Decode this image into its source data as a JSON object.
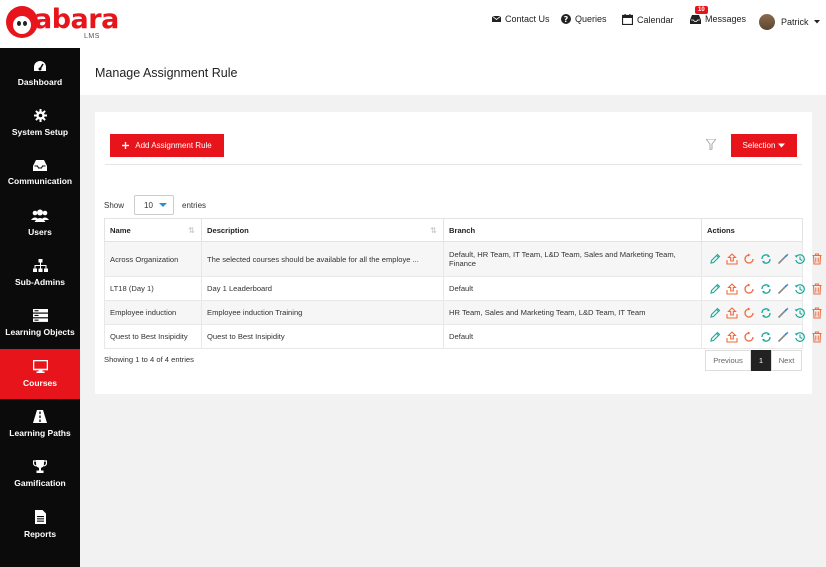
{
  "brand": {
    "logo_text": "abara",
    "logo_sub": "LMS"
  },
  "header": {
    "contact": "Contact Us",
    "queries": "Queries",
    "calendar": "Calendar",
    "messages": "Messages",
    "messages_badge": "10",
    "user": "Patrick"
  },
  "sidebar": {
    "items": [
      {
        "label": "Dashboard",
        "icon": "dashboard-icon"
      },
      {
        "label": "System Setup",
        "icon": "gear-icon"
      },
      {
        "label": "Communication",
        "icon": "inbox-icon"
      },
      {
        "label": "Users",
        "icon": "users-icon"
      },
      {
        "label": "Sub-Admins",
        "icon": "sitemap-icon"
      },
      {
        "label": "Learning Objects",
        "icon": "stack-icon"
      },
      {
        "label": "Courses",
        "icon": "monitor-icon"
      },
      {
        "label": "Learning Paths",
        "icon": "road-icon"
      },
      {
        "label": "Gamification",
        "icon": "trophy-icon"
      },
      {
        "label": "Reports",
        "icon": "document-icon"
      }
    ],
    "active": "Courses"
  },
  "page": {
    "title": "Manage Assignment Rule"
  },
  "toolbar": {
    "add_label": "Add Assignment Rule",
    "selection_label": "Selection"
  },
  "length": {
    "show": "Show",
    "value": "10",
    "entries": "entries"
  },
  "table": {
    "headers": {
      "name": "Name",
      "description": "Description",
      "branch": "Branch",
      "actions": "Actions"
    },
    "rows": [
      {
        "name": "Across Organization",
        "description": "The selected courses should be available for all the employe ...",
        "branch": "Default, HR Team, IT Team, L&D Team, Sales and Marketing Team, Finance"
      },
      {
        "name": "LT18 (Day 1)",
        "description": "Day 1 Leaderboard",
        "branch": "Default"
      },
      {
        "name": "Employee induction",
        "description": "Employee induction Training",
        "branch": "HR Team, Sales and Marketing Team, L&D Team, IT Team"
      },
      {
        "name": "Quest to Best Insipidity",
        "description": "Quest to Best Insipidity",
        "branch": "Default"
      }
    ]
  },
  "footer": {
    "showing": "Showing 1 to 4 of 4 entries",
    "previous": "Previous",
    "page": "1",
    "next": "Next"
  },
  "colors": {
    "accent": "#e8141b",
    "teal": "#1aa99b",
    "orange": "#f06a3f",
    "sidebar": "#0b0b0b"
  }
}
